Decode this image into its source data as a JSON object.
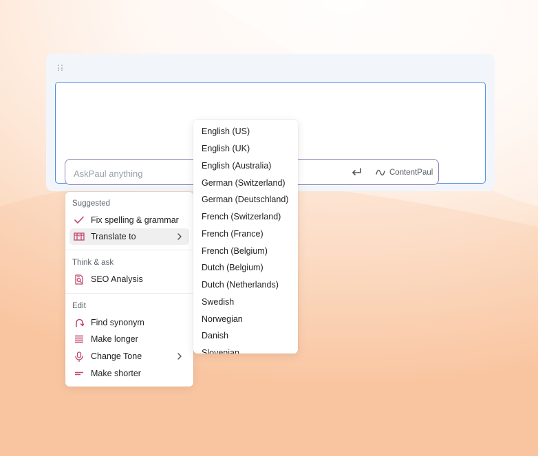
{
  "prompt": {
    "placeholder": "AskPaul anything",
    "brand_name": "ContentPaul"
  },
  "menu": {
    "sections": [
      {
        "title": "Suggested",
        "items": [
          {
            "label": "Fix spelling & grammar",
            "icon": "check-icon"
          },
          {
            "label": "Translate to",
            "icon": "translate-icon",
            "has_submenu": true,
            "active": true
          }
        ]
      },
      {
        "title": "Think & ask",
        "items": [
          {
            "label": "SEO Analysis",
            "icon": "seo-icon"
          }
        ]
      },
      {
        "title": "Edit",
        "items": [
          {
            "label": "Find synonym",
            "icon": "redo-arrow-icon"
          },
          {
            "label": "Make longer",
            "icon": "lines-long-icon"
          },
          {
            "label": "Change Tone",
            "icon": "microphone-icon",
            "has_submenu": true
          },
          {
            "label": "Make shorter",
            "icon": "lines-short-icon"
          }
        ]
      }
    ]
  },
  "languages": [
    "English (US)",
    "English (UK)",
    "English (Australia)",
    "German (Switzerland)",
    "German (Deutschland)",
    "French (Switzerland)",
    "French (France)",
    "French (Belgium)",
    "Dutch (Belgium)",
    "Dutch (Netherlands)",
    "Swedish",
    "Norwegian",
    "Danish",
    "Slovenian"
  ],
  "colors": {
    "accent": "#c2456a",
    "editor_border": "#4a8fe2",
    "prompt_border": "#8f82b8"
  }
}
